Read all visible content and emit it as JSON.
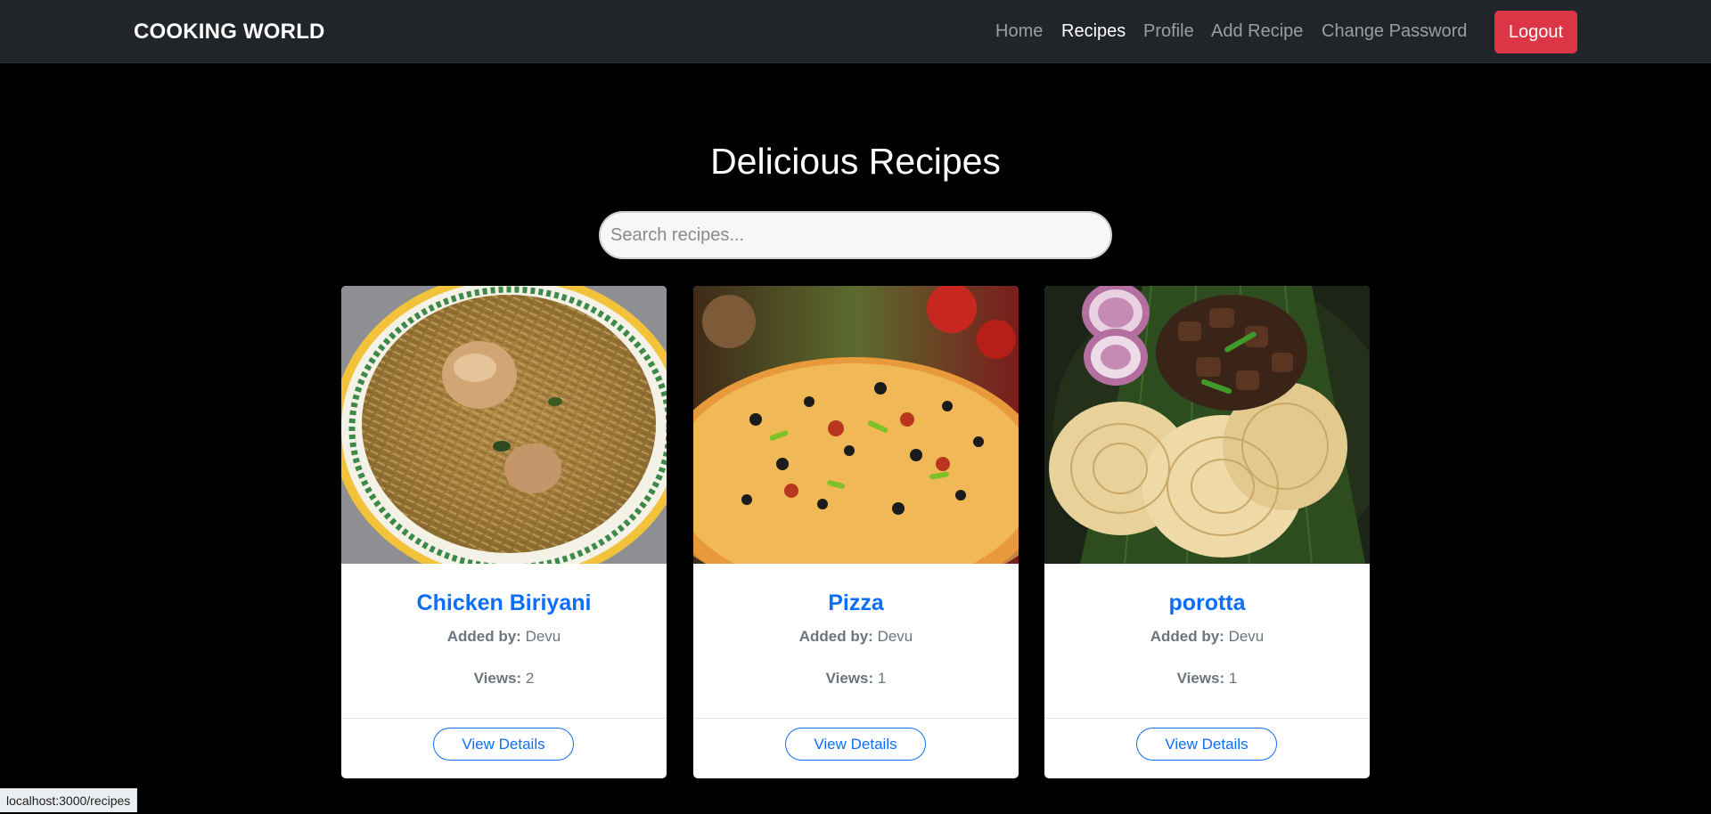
{
  "navbar": {
    "brand": "COOKING WORLD",
    "links": [
      {
        "label": "Home",
        "active": false
      },
      {
        "label": "Recipes",
        "active": true
      },
      {
        "label": "Profile",
        "active": false
      },
      {
        "label": "Add Recipe",
        "active": false
      },
      {
        "label": "Change Password",
        "active": false
      }
    ],
    "logout_label": "Logout"
  },
  "main": {
    "title": "Delicious Recipes",
    "search_placeholder": "Search recipes..."
  },
  "recipes": [
    {
      "name": "Chicken Biriyani",
      "added_by_label": "Added by:",
      "author": "Devu",
      "views_label": "Views:",
      "views": "2",
      "button_label": "View Details",
      "image": "chicken-biriyani-photo"
    },
    {
      "name": "Pizza",
      "added_by_label": "Added by:",
      "author": "Devu",
      "views_label": "Views:",
      "views": "1",
      "button_label": "View Details",
      "image": "pizza-photo"
    },
    {
      "name": "porotta",
      "added_by_label": "Added by:",
      "author": "Devu",
      "views_label": "Views:",
      "views": "1",
      "button_label": "View Details",
      "image": "porotta-photo"
    }
  ],
  "status_bar": {
    "url": "localhost:3000/recipes"
  },
  "colors": {
    "navbar": "#212529",
    "logout": "#dc3545",
    "link": "#0d6efd",
    "background": "#000000"
  }
}
